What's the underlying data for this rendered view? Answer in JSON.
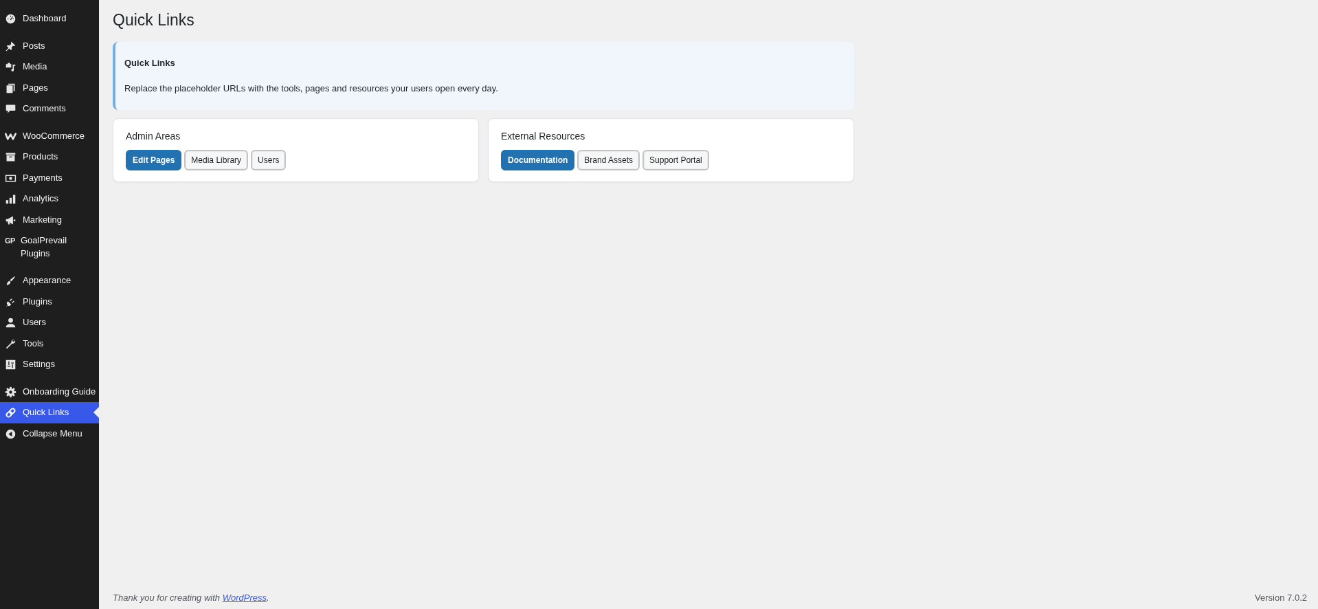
{
  "sidebar": {
    "sections": [
      {
        "items": [
          {
            "label": "Dashboard",
            "selected": false
          }
        ]
      },
      {
        "items": [
          {
            "label": "Posts",
            "selected": false
          },
          {
            "label": "Media",
            "selected": false
          },
          {
            "label": "Pages",
            "selected": false
          },
          {
            "label": "Comments",
            "selected": false
          }
        ]
      },
      {
        "items": [
          {
            "label": "WooCommerce",
            "selected": false
          },
          {
            "label": "Products",
            "selected": false
          },
          {
            "label": "Payments",
            "selected": false
          },
          {
            "label": "Analytics",
            "selected": false
          },
          {
            "label": "Marketing",
            "selected": false
          },
          {
            "label": "GoalPrevail Plugins",
            "icon_text": "GP",
            "selected": false
          }
        ]
      },
      {
        "items": [
          {
            "label": "Appearance",
            "selected": false
          },
          {
            "label": "Plugins",
            "selected": false
          },
          {
            "label": "Users",
            "selected": false
          },
          {
            "label": "Tools",
            "selected": false
          },
          {
            "label": "Settings",
            "selected": false
          }
        ]
      },
      {
        "items": [
          {
            "label": "Onboarding Guide",
            "selected": false
          },
          {
            "label": "Quick Links",
            "selected": true
          },
          {
            "label": "Collapse Menu",
            "selected": false
          }
        ]
      }
    ]
  },
  "page_title": "Quick Links",
  "notice": {
    "title": "Quick Links",
    "text": "Replace the placeholder URLs with the tools, pages and resources your users open every day."
  },
  "panels": [
    {
      "title": "Admin Areas",
      "buttons": [
        {
          "label": "Edit Pages",
          "kind": "primary"
        },
        {
          "label": "Media Library",
          "kind": "secondary"
        },
        {
          "label": "Users",
          "kind": "secondary"
        }
      ]
    },
    {
      "title": "External Resources",
      "buttons": [
        {
          "label": "Documentation",
          "kind": "primary"
        },
        {
          "label": "Brand Assets",
          "kind": "secondary"
        },
        {
          "label": "Support Portal",
          "kind": "secondary"
        }
      ]
    }
  ],
  "footer": {
    "thanks_before": "Thank you for creating with ",
    "thanks_link": "WordPress",
    "thanks_after": ".",
    "version": "Version 7.0.2"
  }
}
